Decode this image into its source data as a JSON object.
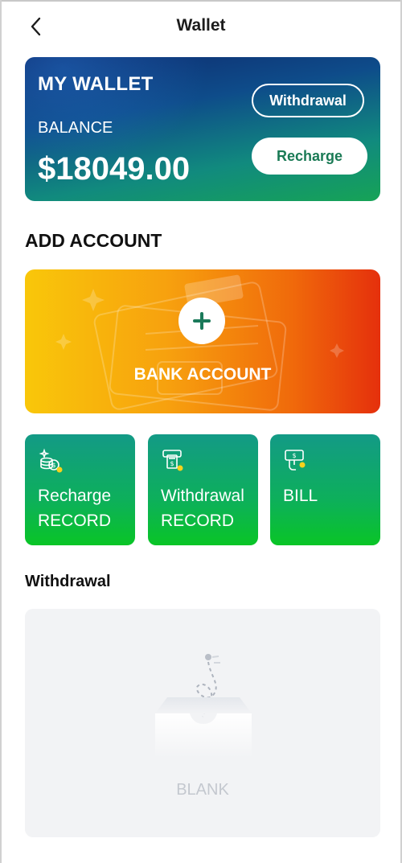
{
  "header": {
    "title": "Wallet",
    "back_icon": "chevron-left-icon"
  },
  "wallet_card": {
    "title": "MY WALLET",
    "balance_label": "BALANCE",
    "balance_value": "$18049.00",
    "withdrawal_button": "Withdrawal",
    "recharge_button": "Recharge"
  },
  "add_account": {
    "title": "ADD ACCOUNT",
    "bank_card_label": "BANK ACCOUNT",
    "plus_icon": "plus-icon"
  },
  "quick_actions": [
    {
      "line1": "Recharge",
      "line2": "RECORD",
      "icon": "coins-icon"
    },
    {
      "line1": "Withdrawal",
      "line2": "RECORD",
      "icon": "atm-withdraw-icon"
    },
    {
      "line1": "BILL",
      "line2": "",
      "icon": "cash-hand-icon"
    }
  ],
  "withdrawal_section": {
    "title": "Withdrawal",
    "empty_text": "BLANK",
    "empty_icon": "empty-box-icon"
  },
  "colors": {
    "wallet_gradient": [
      "#0d2b6e",
      "#16a356"
    ],
    "bank_gradient": [
      "#f9c70a",
      "#e5300c"
    ],
    "tile_gradient": [
      "#139a86",
      "#09c526"
    ],
    "recharge_text": "#1a7a55"
  }
}
